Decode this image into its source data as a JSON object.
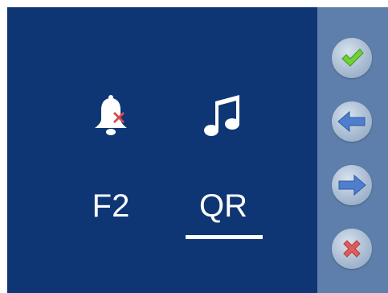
{
  "options": [
    {
      "label": "F2",
      "icon": "bell-muted-icon",
      "selected": false
    },
    {
      "label": "QR",
      "icon": "music-note-icon",
      "selected": true
    }
  ],
  "side_buttons": [
    {
      "icon": "check-icon",
      "action": "confirm"
    },
    {
      "icon": "arrow-left-icon",
      "action": "back"
    },
    {
      "icon": "arrow-right-icon",
      "action": "forward"
    },
    {
      "icon": "close-icon",
      "action": "cancel"
    }
  ],
  "colors": {
    "main_background": "#0e3674",
    "side_background": "#5e7fab",
    "check_green": "#6fd136",
    "arrow_blue": "#4f7fcc",
    "cancel_red": "#e05c5c",
    "text": "#ffffff"
  }
}
